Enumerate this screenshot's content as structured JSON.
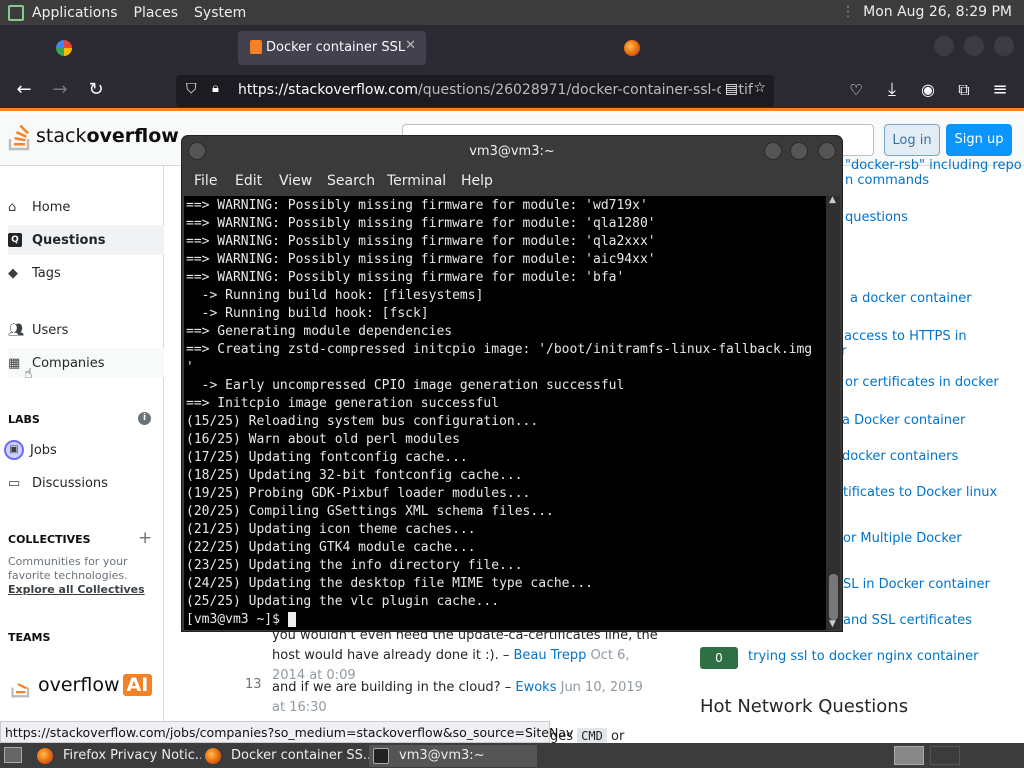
{
  "panel": {
    "menus": [
      "Applications",
      "Places",
      "System"
    ],
    "clock": "Mon Aug 26,  8:29 PM"
  },
  "tabs": [
    {
      "label": ""
    },
    {
      "label": "Docker container SSL"
    },
    {
      "label": ""
    }
  ],
  "nav": {
    "url_host": "https://stackoverflow.com",
    "url_path": "/questions/26028971/docker-container-ssl-certifi"
  },
  "so": {
    "logo_a": "stack",
    "logo_b": "overflow",
    "login": "Log in",
    "signup": "Sign up",
    "sidebar": {
      "items": [
        "Home",
        "Questions",
        "Tags",
        "Users",
        "Companies",
        "Jobs",
        "Discussions"
      ],
      "labs": "LABS",
      "collectives": "COLLECTIVES",
      "collectives_desc": "Communities for your favorite technologies.",
      "explore": "Explore all Collectives",
      "teams": "TEAMS",
      "ai_logo": "overflow",
      "ai_badge": "AI"
    },
    "right_links": [
      "\"docker-rsb\" including repo",
      "n commands",
      "questions",
      "a docker container",
      "access to HTTPS in",
      "r",
      "or certificates in docker",
      "a Docker container",
      "docker containers",
      "tificates to Docker linux",
      "or Multiple Docker",
      "SL in Docker container",
      "and SSL certificates",
      "trying ssl to docker nginx container"
    ],
    "vote_badge": "0",
    "hot_title": "Hot Network Questions",
    "comments": [
      {
        "text": "you wouldn't even need the update-ca-certificates line, the host would have already done it :).",
        "user": "Beau Trepp",
        "date": "Oct 6, 2014 at 0:09"
      },
      {
        "score": "13",
        "text": "and if we are building in the cloud?",
        "user": "Ewoks",
        "date": "Jun 10, 2019 at 16:30"
      },
      {
        "tail": "ges",
        "code": "CMD",
        "tail2": "or"
      }
    ]
  },
  "terminal": {
    "title": "vm3@vm3:~",
    "menu": [
      "File",
      "Edit",
      "View",
      "Search",
      "Terminal",
      "Help"
    ],
    "lines": [
      "==> WARNING: Possibly missing firmware for module: 'wd719x'",
      "==> WARNING: Possibly missing firmware for module: 'qla1280'",
      "==> WARNING: Possibly missing firmware for module: 'qla2xxx'",
      "==> WARNING: Possibly missing firmware for module: 'aic94xx'",
      "==> WARNING: Possibly missing firmware for module: 'bfa'",
      "  -> Running build hook: [filesystems]",
      "  -> Running build hook: [fsck]",
      "==> Generating module dependencies",
      "==> Creating zstd-compressed initcpio image: '/boot/initramfs-linux-fallback.img",
      "'",
      "  -> Early uncompressed CPIO image generation successful",
      "==> Initcpio image generation successful",
      "(15/25) Reloading system bus configuration...",
      "(16/25) Warn about old perl modules",
      "(17/25) Updating fontconfig cache...",
      "(18/25) Updating 32-bit fontconfig cache...",
      "(19/25) Probing GDK-Pixbuf loader modules...",
      "(20/25) Compiling GSettings XML schema files...",
      "(21/25) Updating icon theme caches...",
      "(22/25) Updating GTK4 module cache...",
      "(23/25) Updating the info directory file...",
      "(24/25) Updating the desktop file MIME type cache...",
      "(25/25) Updating the vlc plugin cache..."
    ],
    "prompt": "[vm3@vm3 ~]$ "
  },
  "status_url": "https://stackoverflow.com/jobs/companies?so_medium=stackoverflow&so_source=SiteNav",
  "taskbar": [
    {
      "label": "Firefox Privacy Notic..."
    },
    {
      "label": "Docker container SS..."
    },
    {
      "label": "vm3@vm3:~"
    }
  ]
}
